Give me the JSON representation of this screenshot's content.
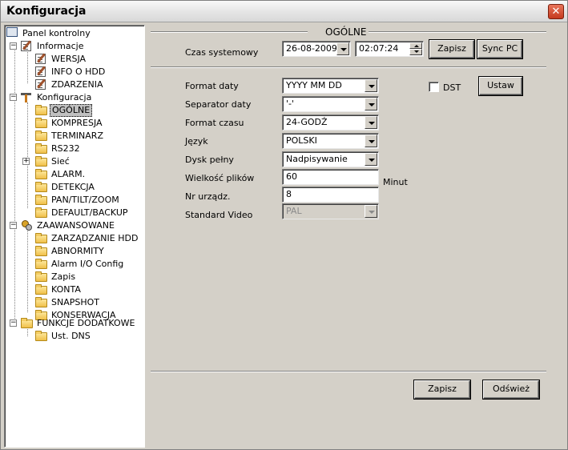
{
  "window": {
    "title": "Konfiguracja",
    "close_glyph": "✕"
  },
  "tree": {
    "root": "Panel kontrolny",
    "informacje": "Informacje",
    "wersja": "WERSJA",
    "info_hdd": "INFO O HDD",
    "zdarzenia": "ZDARZENIA",
    "konfiguracja": "Konfiguracja",
    "ogolne": "OGÓLNE",
    "kompresja": "KOMPRESJA",
    "terminarz": "TERMINARZ",
    "rs232": "RS232",
    "siec": "Sieć",
    "alarm": "ALARM.",
    "detekcja": "DETEKCJA",
    "ptz": "PAN/TILT/ZOOM",
    "default_backup": "DEFAULT/BACKUP",
    "zaawansowane": "ZAAWANSOWANE",
    "zarzadzanie_hdd": "ZARZĄDZANIE HDD",
    "abnormity": "ABNORMITY",
    "alarm_io": "Alarm I/O Config",
    "zapis": "Zapis",
    "konta": "KONTA",
    "snapshot": "SNAPSHOT",
    "konserwacja": "KONSERWACJA",
    "funkcje": "FUNKCJE DODATKOWE",
    "ust_dns": "Ust. DNS",
    "expander_minus": "−",
    "expander_plus": "+"
  },
  "section": {
    "title": "OGÓLNE"
  },
  "system_time": {
    "label": "Czas systemowy",
    "date": "26-08-2009",
    "time": "02:07:24",
    "save_button": "Zapisz",
    "sync_button": "Sync PC"
  },
  "settings": {
    "date_format": {
      "label": "Format daty",
      "value": "YYYY MM DD"
    },
    "date_separator": {
      "label": "Separator daty",
      "value": "'-'"
    },
    "time_format": {
      "label": "Format czasu",
      "value": "24-GODŹ"
    },
    "language": {
      "label": "Język",
      "value": "POLSKI"
    },
    "disk_full": {
      "label": "Dysk pełny",
      "value": "Nadpisywanie"
    },
    "file_size": {
      "label": "Wielkość plików",
      "value": "60",
      "unit": "Minut"
    },
    "device_no": {
      "label": "Nr urządz.",
      "value": "8"
    },
    "video_standard": {
      "label": "Standard Video",
      "value": "PAL"
    }
  },
  "dst": {
    "label": "DST",
    "checked": false,
    "button": "Ustaw"
  },
  "footer": {
    "save_button": "Zapisz",
    "refresh_button": "Odśwież"
  }
}
